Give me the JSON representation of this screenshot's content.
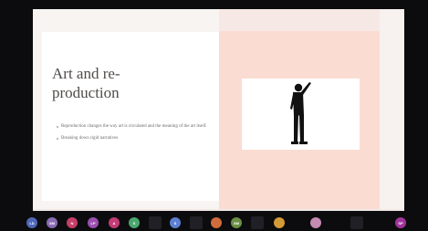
{
  "slide": {
    "title": "Art and re-\nproduction",
    "bullets": [
      "Reproduction changes the way art is circulated and the meaning of the art itself.",
      "Breaking down rigid narratives"
    ],
    "image_icon": "person-silhouette-icon"
  },
  "participants": [
    {
      "initials": "LD",
      "color": "#4f67b8"
    },
    {
      "initials": "SM",
      "color": "#8a6bb3"
    },
    {
      "initials": "N",
      "color": "#c83e69"
    },
    {
      "initials": "LP",
      "color": "#9b4fb0"
    },
    {
      "initials": "A",
      "color": "#c43b76"
    },
    {
      "initials": "S",
      "color": "#49a76d"
    },
    {
      "initials": "",
      "color": "#2b2b31",
      "camera": true
    },
    {
      "initials": "S",
      "color": "#5c7fd1"
    },
    {
      "initials": "",
      "color": "#2b2b31",
      "camera": true
    },
    {
      "initials": "",
      "color": "#d06b3c"
    },
    {
      "initials": "SM",
      "color": "#6b8f43"
    },
    {
      "initials": "",
      "color": "#2b2b31",
      "camera": true
    },
    {
      "initials": "",
      "color": "#d49a36"
    },
    {
      "initials": "",
      "color": "#c58ab1"
    },
    {
      "initials": "",
      "color": "#2b2b31",
      "camera": true
    },
    {
      "initials": "SP",
      "color": "#a0349a"
    }
  ]
}
